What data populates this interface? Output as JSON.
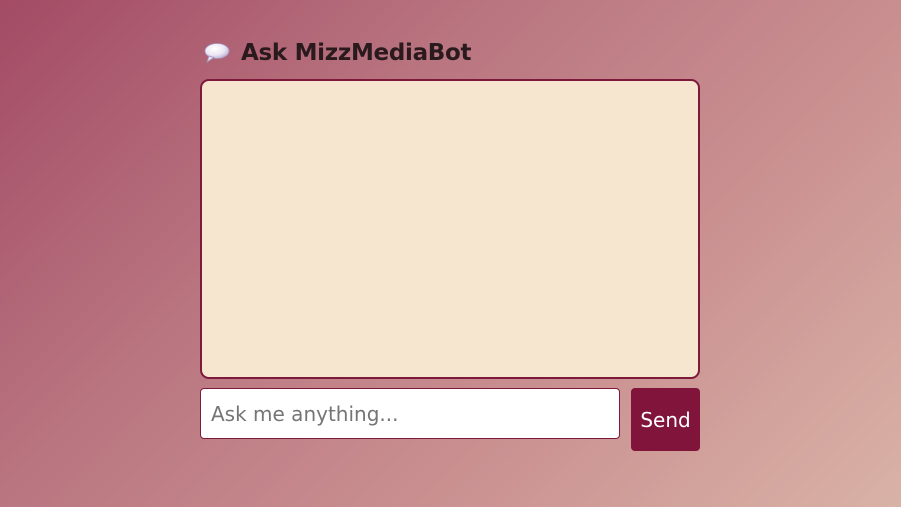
{
  "header": {
    "icon": "speech-bubble-icon",
    "title": "Ask MizzMediaBot"
  },
  "chat": {
    "messages": []
  },
  "input": {
    "value": "",
    "placeholder": "Ask me anything..."
  },
  "send_button": {
    "label": "Send"
  },
  "colors": {
    "accent": "#80143a",
    "chat_background": "#f7e6cf",
    "gradient_start": "#a34b65",
    "gradient_end": "#d9b2a6"
  }
}
